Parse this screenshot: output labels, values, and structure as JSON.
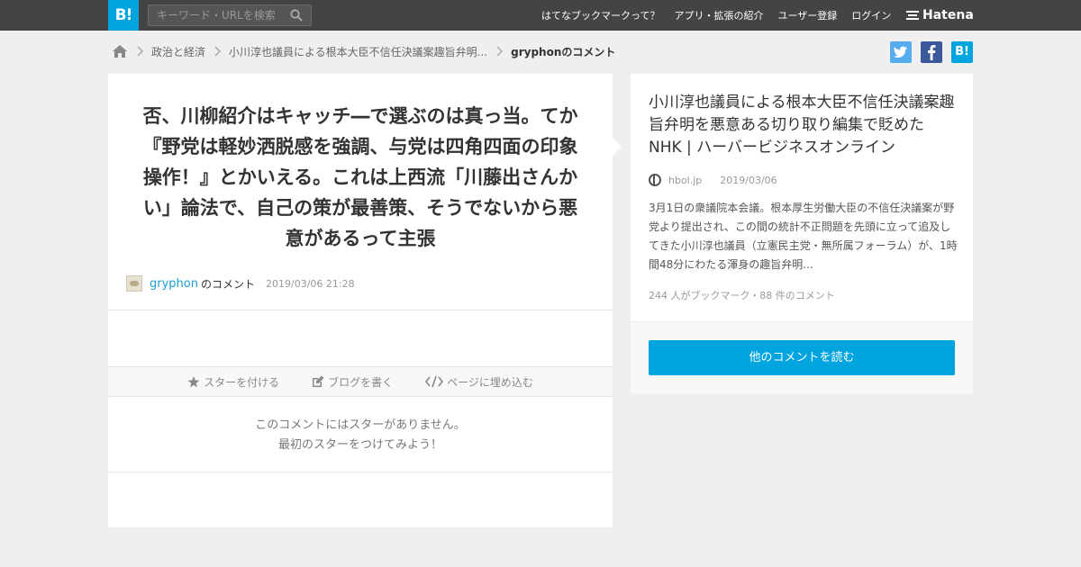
{
  "header": {
    "logo": "B!",
    "search_placeholder": "キーワード・URLを検索",
    "nav": [
      {
        "label": "はてなブックマークって？"
      },
      {
        "label": "アプリ・拡張の紹介"
      },
      {
        "label": "ユーザー登録"
      },
      {
        "label": "ログイン"
      }
    ],
    "hatena_label": "Hatena"
  },
  "breadcrumb": {
    "items": [
      "政治と経済",
      "小川淳也議員による根本大臣不信任決議案趣旨弁明..."
    ],
    "current": "gryphonのコメント"
  },
  "share": {
    "hatebu_label": "B!"
  },
  "comment": {
    "text": "否、川柳紹介はキャッチ―で選ぶのは真っ当。てか『野党は軽妙洒脱感を強調、与党は四角四面の印象操作！』とかいえる。これは上西流「川藤出さんかい」論法で、自己の策が最善策、そうでないから悪意があるって主張",
    "user": "gryphon",
    "user_suffix": "のコメント",
    "date": "2019/03/06 21:28"
  },
  "actions": {
    "star": "スターを付ける",
    "blog": "ブログを書く",
    "embed": "ページに埋め込む"
  },
  "no_star": {
    "line1": "このコメントにはスターがありません。",
    "line2": "最初のスターをつけてみよう！"
  },
  "entry": {
    "title": "小川淳也議員による根本大臣不信任決議案趣旨弁明を悪意ある切り取り編集で貶めたNHK | ハーバービジネスオンライン",
    "site": "hbol.jp",
    "date": "2019/03/06",
    "summary": "3月1日の衆議院本会議。根本厚生労働大臣の不信任決議案が野党より提出され、この間の統計不正問題を先頭に立って追及してきた小川淳也議員（立憲民主党・無所属フォーラム）が、1時間48分にわたる渾身の趣旨弁明...",
    "stats": "244 人がブックマーク・88 件のコメント",
    "read_more": "他のコメントを読む"
  },
  "colors": {
    "accent": "#00a4de",
    "topbar": "#444444",
    "twitter": "#55acee",
    "facebook": "#3b5998",
    "user_link": "#1a9ed1"
  }
}
